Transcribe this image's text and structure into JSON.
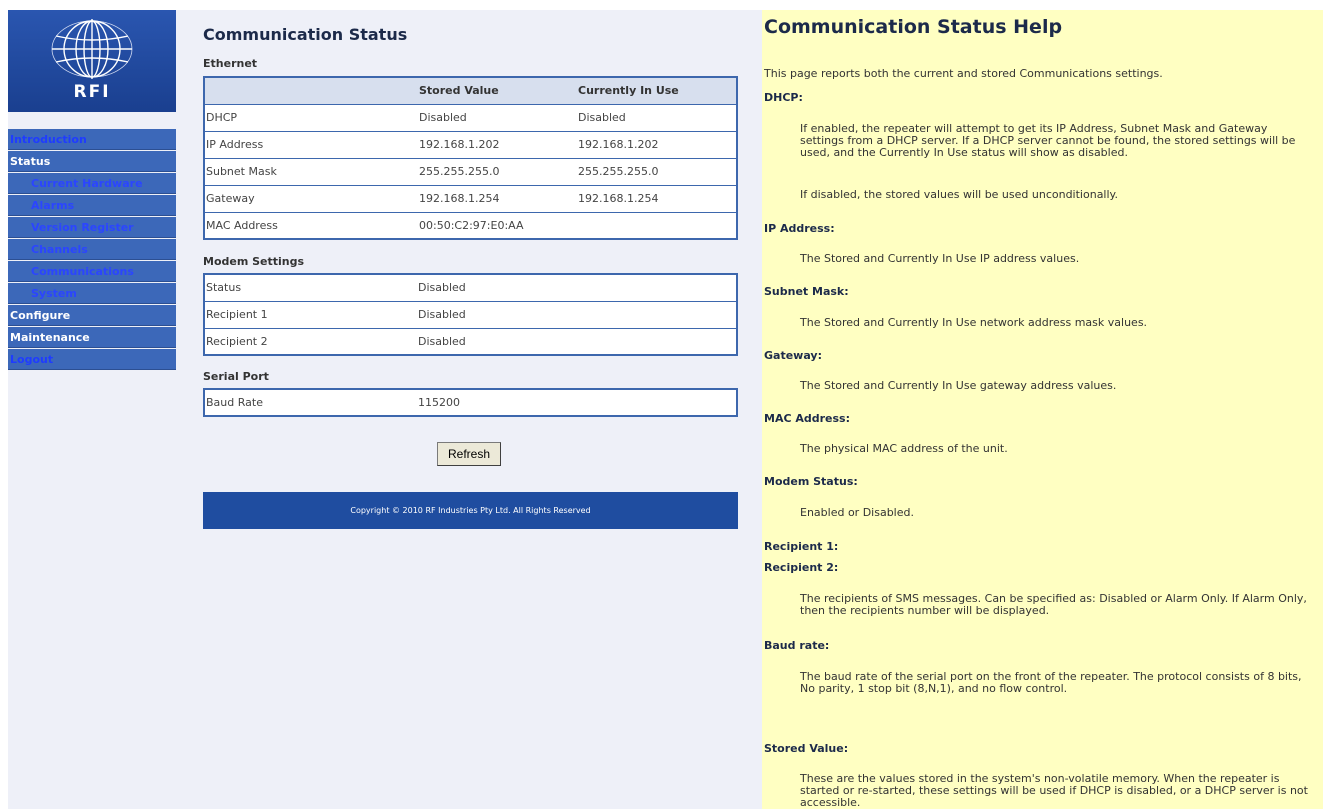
{
  "logo": {
    "text": "RFI"
  },
  "nav": {
    "items": [
      {
        "label": "Introduction",
        "level": 1,
        "style": "link"
      },
      {
        "label": "Status",
        "level": 1,
        "style": "white"
      },
      {
        "label": "Current Hardware",
        "level": 2
      },
      {
        "label": "Alarms",
        "level": 2
      },
      {
        "label": "Version Register",
        "level": 2
      },
      {
        "label": "Channels",
        "level": 2
      },
      {
        "label": "Communications",
        "level": 2
      },
      {
        "label": "System",
        "level": 2
      },
      {
        "label": "Configure",
        "level": 1,
        "style": "white"
      },
      {
        "label": "Maintenance",
        "level": 1,
        "style": "white"
      },
      {
        "label": "Logout",
        "level": 1,
        "style": "link"
      }
    ]
  },
  "main": {
    "title": "Communication Status",
    "ethernet": {
      "title": "Ethernet",
      "headers": [
        "",
        "Stored Value",
        "Currently In Use"
      ],
      "rows": [
        [
          "DHCP",
          "Disabled",
          "Disabled"
        ],
        [
          "IP Address",
          "192.168.1.202",
          "192.168.1.202"
        ],
        [
          "Subnet Mask",
          "255.255.255.0",
          "255.255.255.0"
        ],
        [
          "Gateway",
          "192.168.1.254",
          "192.168.1.254"
        ],
        [
          "MAC Address",
          "00:50:C2:97:E0:AA",
          ""
        ]
      ]
    },
    "modem": {
      "title": "Modem Settings",
      "rows": [
        [
          "Status",
          "Disabled"
        ],
        [
          "Recipient 1",
          "Disabled"
        ],
        [
          "Recipient 2",
          "Disabled"
        ]
      ]
    },
    "serial": {
      "title": "Serial Port",
      "rows": [
        [
          "Baud Rate",
          "115200"
        ]
      ]
    },
    "refresh_label": "Refresh",
    "footer": "Copyright © 2010 RF Industries Pty Ltd. All Rights Reserved"
  },
  "help": {
    "title": "Communication Status Help",
    "intro": "This page reports both the current and stored Communications settings.",
    "dhcp_h": "DHCP:",
    "dhcp_1": "If enabled, the repeater will attempt to get its IP Address, Subnet Mask and Gateway settings from a DHCP server. If a DHCP server cannot be found, the stored settings will be used, and the Currently In Use status will show as disabled.",
    "dhcp_2": "If disabled, the stored values will be used unconditionally.",
    "ip_h": "IP Address:",
    "ip_1": "The Stored and Currently In Use IP address values.",
    "subnet_h": "Subnet Mask:",
    "subnet_1": "The Stored and Currently In Use network address mask values.",
    "gateway_h": "Gateway:",
    "gateway_1": "The Stored and Currently In Use gateway address values.",
    "mac_h": "MAC Address:",
    "mac_1": "The physical MAC address of the unit.",
    "modem_h": "Modem Status:",
    "modem_1": "Enabled or Disabled.",
    "rec1_h": "Recipient 1:",
    "rec2_h": "Recipient 2:",
    "rec_1": "The recipients of SMS messages. Can be specified as: Disabled or Alarm Only. If Alarm Only, then the recipients number will be displayed.",
    "baud_h": "Baud rate:",
    "baud_1": "The baud rate of the serial port on the front of the repeater. The protocol consists of 8 bits, No parity, 1 stop bit (8,N,1), and no flow control.",
    "stored_h": "Stored Value:",
    "stored_1": "These are the values stored in the system's non-volatile memory. When the repeater is started or re-started, these settings will be used if DHCP is disabled, or a DHCP server is not accessible."
  }
}
